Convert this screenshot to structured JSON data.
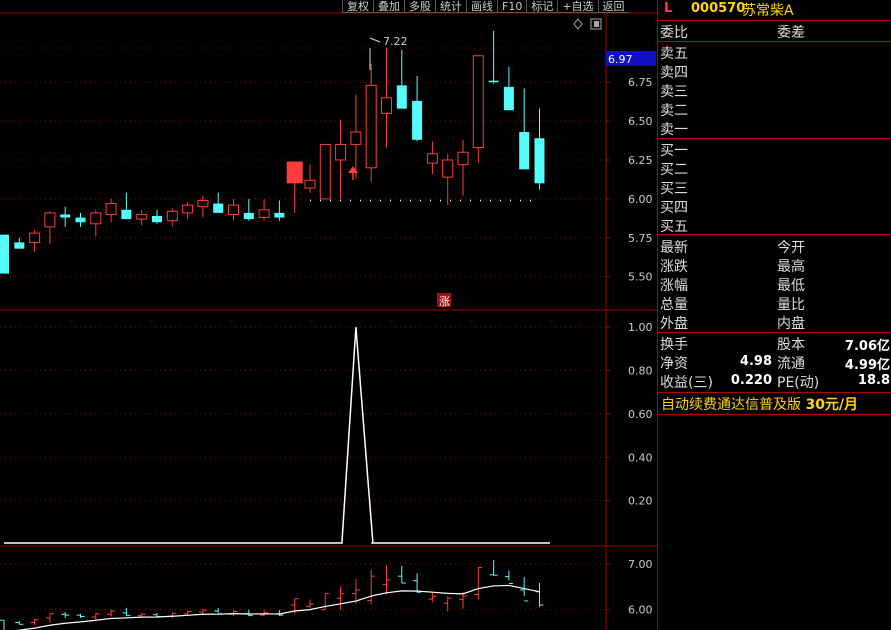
{
  "toolbar": {
    "items": [
      "复权",
      "叠加",
      "多股",
      "统计",
      "画线",
      "F10",
      "标记",
      "+自选",
      "返回"
    ]
  },
  "stock": {
    "market_mark": "L",
    "code": "000570",
    "name": "苏常柴A"
  },
  "main_chart": {
    "price_marker": "7.22",
    "current_price_tag": "6.97",
    "zhang_tag": "涨",
    "y_ticks": [
      "6.75",
      "6.50",
      "6.25",
      "6.00",
      "5.75",
      "5.50"
    ]
  },
  "indicator": {
    "y_ticks": [
      "1.00",
      "0.80",
      "0.60",
      "0.40",
      "0.20"
    ]
  },
  "volume": {
    "y_ticks": [
      "7.00",
      "6.00"
    ]
  },
  "panel": {
    "weibi_label": "委比",
    "weicha_label": "委差",
    "sell_rows": [
      "卖五",
      "卖四",
      "卖三",
      "卖二",
      "卖一"
    ],
    "buy_rows": [
      "买一",
      "买二",
      "买三",
      "买四",
      "买五"
    ],
    "quote_left": [
      "最新",
      "涨跌",
      "涨幅",
      "总量",
      "外盘"
    ],
    "quote_right": [
      "今开",
      "最高",
      "最低",
      "量比",
      "内盘"
    ],
    "turnover_label": "换手",
    "equity_label": "股本",
    "equity_value": "7.06亿",
    "nav_label": "净资",
    "nav_value": "4.98",
    "float_label": "流通",
    "float_value": "4.99亿",
    "eps_label": "收益(三)",
    "eps_value": "0.220",
    "pe_label": "PE(动)",
    "pe_value": "18.8",
    "ad_text": "自动续费通达信普及版",
    "ad_price": "30元/月"
  },
  "chart_data": {
    "type": "candlestick",
    "x": [
      1,
      2,
      3,
      4,
      5,
      6,
      7,
      8,
      9,
      10,
      11,
      12,
      13,
      14,
      15,
      16,
      17,
      18,
      19,
      20,
      21,
      22,
      23,
      24,
      25,
      26,
      27,
      28,
      29,
      30,
      31,
      32,
      33,
      34,
      35,
      36
    ],
    "series": [
      {
        "values_open": [
          5.77,
          5.72,
          5.72,
          5.82,
          5.9,
          5.88,
          5.84,
          5.9,
          5.93,
          5.87,
          5.89,
          5.86,
          5.91,
          5.95,
          5.97,
          5.9,
          5.91,
          5.88,
          5.91,
          6.1,
          6.07,
          6.0,
          6.25,
          6.35,
          6.2,
          6.55,
          6.73,
          6.63,
          6.23,
          6.14,
          6.22,
          6.33,
          6.76,
          6.72,
          6.43,
          6.39
        ],
        "values_high": [
          5.77,
          5.75,
          5.8,
          5.92,
          5.95,
          5.91,
          5.93,
          6.0,
          6.04,
          5.93,
          5.93,
          5.94,
          5.98,
          6.02,
          6.04,
          6.0,
          6.0,
          6.0,
          5.99,
          6.24,
          6.22,
          6.35,
          6.51,
          6.67,
          6.87,
          6.97,
          6.96,
          6.79,
          6.37,
          6.29,
          6.38,
          6.92,
          7.08,
          6.85,
          6.71,
          6.58
        ],
        "values_low": [
          5.52,
          5.68,
          5.66,
          5.71,
          5.82,
          5.82,
          5.76,
          5.85,
          5.87,
          5.83,
          5.84,
          5.82,
          5.87,
          5.88,
          5.93,
          5.86,
          5.86,
          5.86,
          5.86,
          5.91,
          6.04,
          6.0,
          6.0,
          6.13,
          6.11,
          6.33,
          6.58,
          6.37,
          6.16,
          5.96,
          6.02,
          6.23,
          6.74,
          6.64,
          6.3,
          6.06
        ],
        "values_close": [
          5.52,
          5.68,
          5.78,
          5.91,
          5.88,
          5.85,
          5.91,
          5.97,
          5.87,
          5.9,
          5.85,
          5.92,
          5.96,
          5.99,
          5.91,
          5.96,
          5.87,
          5.93,
          5.88,
          6.24,
          6.12,
          6.35,
          6.35,
          6.43,
          6.73,
          6.65,
          6.58,
          6.38,
          6.29,
          6.25,
          6.3,
          6.92,
          6.75,
          6.57,
          6.19,
          6.1
        ]
      }
    ],
    "indicator_values": [
      0,
      0,
      0,
      0,
      0,
      0,
      0,
      0,
      0,
      0,
      0,
      0,
      0,
      0,
      0,
      0,
      0,
      0,
      0,
      0,
      0,
      0,
      0,
      1,
      0,
      0,
      0,
      0,
      0,
      0,
      0,
      0,
      0,
      0,
      0,
      0
    ],
    "main_ylim": [
      5.35,
      7.15
    ],
    "indicator_ylim": [
      0,
      1.07
    ],
    "volume_ylim": [
      5.6,
      7.3
    ]
  },
  "colors": {
    "up": "#ff3b3b",
    "down": "#54fcfc",
    "grid": "#a00000",
    "line": "#ffffff",
    "accent": "#ffd400"
  }
}
